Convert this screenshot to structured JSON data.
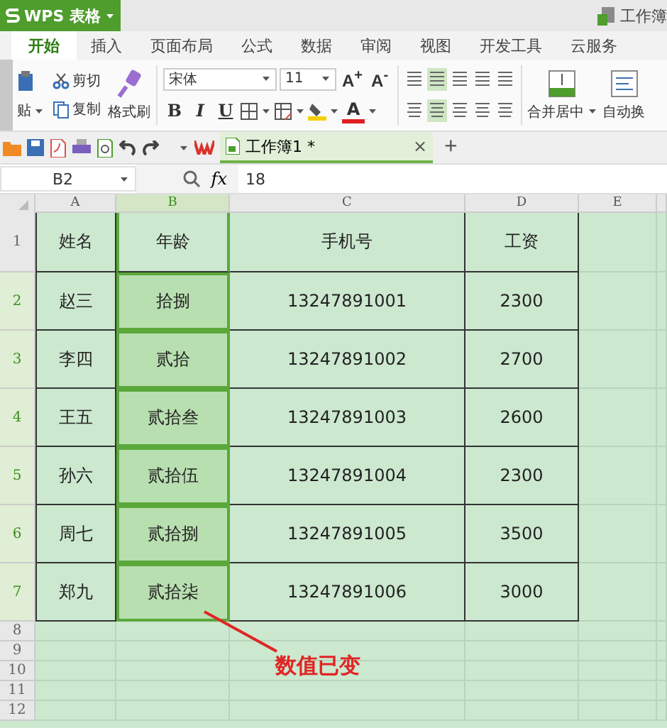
{
  "title_bar": {
    "app_button": "WPS 表格",
    "doc_title": "工作簿"
  },
  "tabs": [
    {
      "label": "开始",
      "selected": true
    },
    {
      "label": "插入",
      "selected": false
    },
    {
      "label": "页面布局",
      "selected": false
    },
    {
      "label": "公式",
      "selected": false
    },
    {
      "label": "数据",
      "selected": false
    },
    {
      "label": "审阅",
      "selected": false
    },
    {
      "label": "视图",
      "selected": false
    },
    {
      "label": "开发工具",
      "selected": false
    },
    {
      "label": "云服务",
      "selected": false
    }
  ],
  "ribbon": {
    "paste": "贴",
    "cut": "剪切",
    "copy": "复制",
    "format_painter": "格式刷",
    "font": "宋体",
    "font_size": "11",
    "grow_font": "A$^{+}$",
    "shrink_font": "A$^{-}$",
    "bold": "B",
    "italic": "I",
    "underline": "U",
    "font_color": "A",
    "merge": "合并居中",
    "wrap": "自动换"
  },
  "quick_bar": {
    "doc_tab": "工作簿1 *",
    "close": "×",
    "new_tab": "+"
  },
  "formula_bar": {
    "name_box": "B2",
    "fx": "fx",
    "value": "18"
  },
  "sheet": {
    "columns": [
      {
        "label": "A",
        "selected": false
      },
      {
        "label": "B",
        "selected": true
      },
      {
        "label": "C",
        "selected": false
      },
      {
        "label": "D",
        "selected": false
      },
      {
        "label": "E",
        "selected": false
      }
    ],
    "rows": [
      {
        "number": "1",
        "selected": false,
        "cells": [
          "姓名",
          "年龄",
          "手机号",
          "工资"
        ]
      },
      {
        "number": "2",
        "selected": true,
        "cells": [
          "赵三",
          "拾捌",
          "13247891001",
          "2300"
        ]
      },
      {
        "number": "3",
        "selected": true,
        "cells": [
          "李四",
          "贰拾",
          "13247891002",
          "2700"
        ]
      },
      {
        "number": "4",
        "selected": true,
        "cells": [
          "王五",
          "贰拾叁",
          "13247891003",
          "2600"
        ]
      },
      {
        "number": "5",
        "selected": true,
        "cells": [
          "孙六",
          "贰拾伍",
          "13247891004",
          "2300"
        ]
      },
      {
        "number": "6",
        "selected": true,
        "cells": [
          "周七",
          "贰拾捌",
          "13247891005",
          "3500"
        ]
      },
      {
        "number": "7",
        "selected": true,
        "cells": [
          "郑九",
          "贰拾柒",
          "13247891006",
          "3000"
        ]
      },
      {
        "number": "8",
        "selected": false
      },
      {
        "number": "9",
        "selected": false
      },
      {
        "number": "10",
        "selected": false
      },
      {
        "number": "11",
        "selected": false
      },
      {
        "number": "12",
        "selected": false
      }
    ]
  },
  "annotation": {
    "text": "数值已变"
  }
}
